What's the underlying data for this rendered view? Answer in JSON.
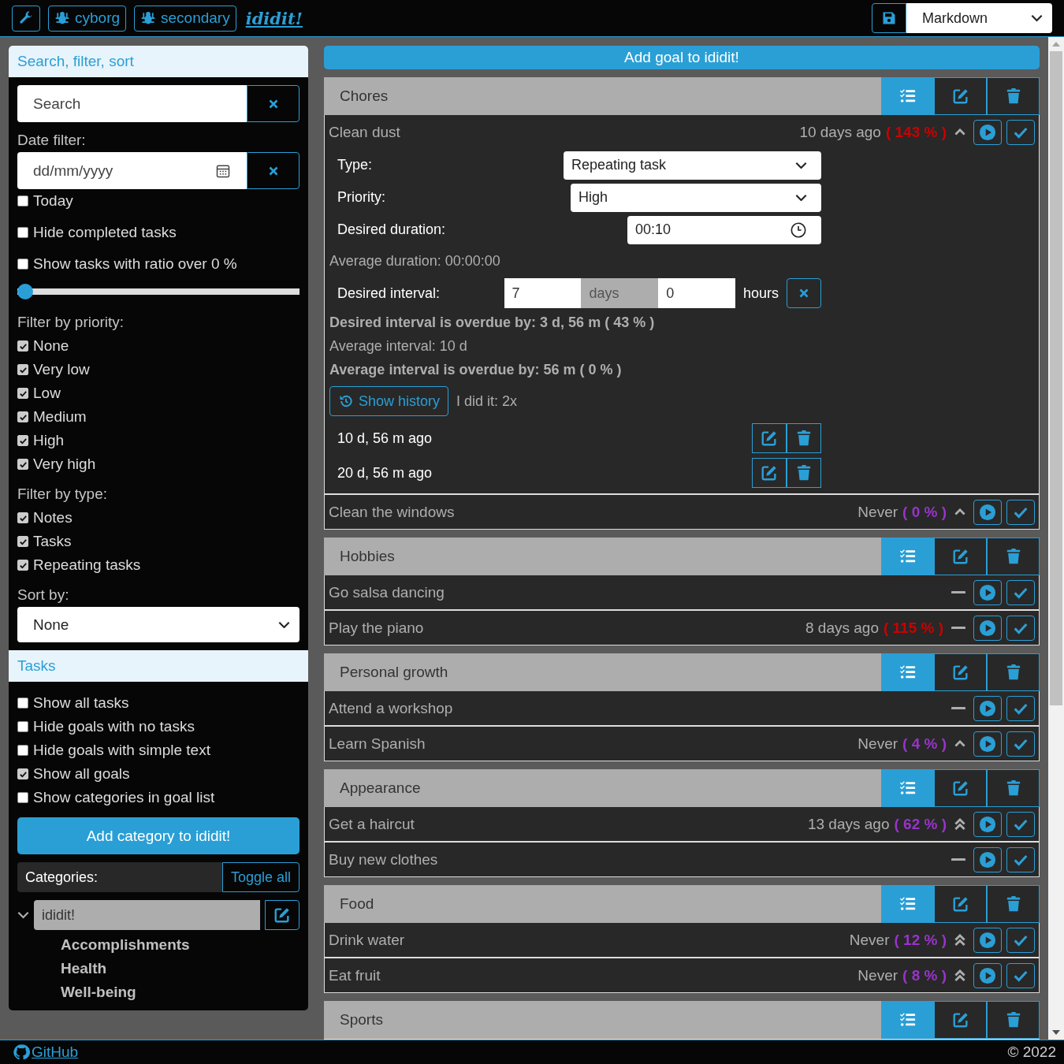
{
  "header": {
    "theme_buttons": [
      "cyborg",
      "secondary"
    ],
    "logo": "ididit!",
    "format_select": "Markdown"
  },
  "sidebar": {
    "title": "Search, filter, sort",
    "search": {
      "placeholder": "Search"
    },
    "date_filter": {
      "label": "Date filter:",
      "placeholder": "dd/mm/yyyy"
    },
    "options": [
      {
        "label": "Today",
        "checked": false
      },
      {
        "label": "Hide completed tasks",
        "checked": false
      },
      {
        "label": "Show tasks with ratio over 0 %",
        "checked": false
      }
    ],
    "ratio_slider": {
      "level": 0
    },
    "priority_filter": {
      "label": "Filter by priority:",
      "items": [
        {
          "label": "None",
          "checked": true
        },
        {
          "label": "Very low",
          "checked": true
        },
        {
          "label": "Low",
          "checked": true
        },
        {
          "label": "Medium",
          "checked": true
        },
        {
          "label": "High",
          "checked": true
        },
        {
          "label": "Very high",
          "checked": true
        }
      ]
    },
    "type_filter": {
      "label": "Filter by type:",
      "items": [
        {
          "label": "Notes",
          "checked": true
        },
        {
          "label": "Tasks",
          "checked": true
        },
        {
          "label": "Repeating tasks",
          "checked": true
        }
      ]
    },
    "sort": {
      "label": "Sort by:",
      "value": "None"
    },
    "tasks_title": "Tasks",
    "task_options": [
      {
        "label": "Show all tasks",
        "checked": false
      },
      {
        "label": "Hide goals with no tasks",
        "checked": false
      },
      {
        "label": "Hide goals with simple text",
        "checked": false
      },
      {
        "label": "Show all goals",
        "checked": true
      },
      {
        "label": "Show categories in goal list",
        "checked": false
      }
    ],
    "add_category": "Add category to ididit!",
    "categories": {
      "label": "Categories:",
      "toggle": "Toggle all",
      "tree": [
        {
          "name": "ididit!",
          "expanded": true,
          "children": [
            {
              "name": "Accomplishments"
            },
            {
              "name": "Health"
            },
            {
              "name": "Well-being"
            }
          ]
        }
      ]
    }
  },
  "main": {
    "add_goal": "Add goal to ididit!",
    "groups": [
      {
        "name": "Chores",
        "goals": [
          {
            "name": "Clean dust",
            "last": "10 days ago",
            "ratio": "( 143 % )",
            "overdue": true,
            "kind": "high",
            "details": {
              "type": {
                "label": "Type:",
                "value": "Repeating task"
              },
              "priority": {
                "label": "Priority:",
                "value": "High"
              },
              "duration": {
                "label": "Desired duration:",
                "value": "00:10"
              },
              "average_duration": "Average duration: 00:00:00",
              "interval": {
                "label": "Desired interval:",
                "days": "7",
                "days_unit": "days",
                "hours": "0",
                "hours_unit": "hours"
              },
              "interval_overdue": "Desired interval is overdue by: 3 d, 56 m ( 43 % )",
              "average_interval": "Average interval: 10 d",
              "average_overdue": "Average interval is overdue by: 56 m ( 0 % )",
              "history_button": "Show history",
              "count": "I did it: 2x",
              "history": [
                "10 d, 56 m ago",
                "20 d, 56 m ago"
              ]
            }
          },
          {
            "name": "Clean the windows",
            "last": "Never",
            "ratio": "( 0 % )",
            "overdue": false,
            "kind": "high"
          }
        ]
      },
      {
        "name": "Hobbies",
        "goals": [
          {
            "name": "Go salsa dancing",
            "kind": "medium"
          },
          {
            "name": "Play the piano",
            "last": "8 days ago",
            "ratio": "( 115 % )",
            "overdue": true,
            "kind": "medium"
          }
        ]
      },
      {
        "name": "Personal growth",
        "goals": [
          {
            "name": "Attend a workshop",
            "kind": "medium"
          },
          {
            "name": "Learn Spanish",
            "last": "Never",
            "ratio": "( 4 % )",
            "overdue": false,
            "kind": "high"
          }
        ]
      },
      {
        "name": "Appearance",
        "goals": [
          {
            "name": "Get a haircut",
            "last": "13 days ago",
            "ratio": "( 62 % )",
            "overdue": false,
            "kind": "highest"
          },
          {
            "name": "Buy new clothes",
            "kind": "medium"
          }
        ]
      },
      {
        "name": "Food",
        "goals": [
          {
            "name": "Drink water",
            "last": "Never",
            "ratio": "( 12 % )",
            "overdue": false,
            "kind": "highest"
          },
          {
            "name": "Eat fruit",
            "last": "Never",
            "ratio": "( 8 % )",
            "overdue": false,
            "kind": "highest"
          }
        ]
      },
      {
        "name": "Sports"
      }
    ]
  },
  "footer": {
    "link": "GitHub",
    "copyright": "© 2022"
  }
}
